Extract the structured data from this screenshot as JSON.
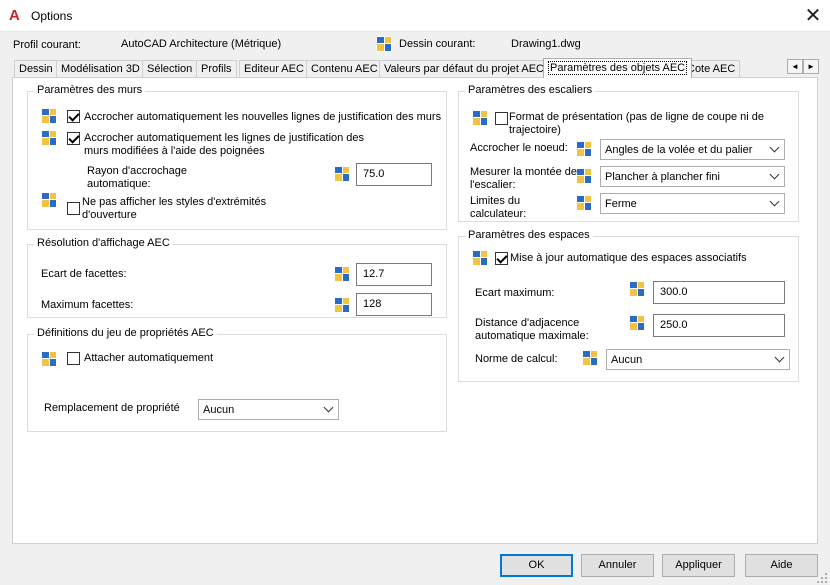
{
  "window": {
    "title": "Options",
    "close": "✕"
  },
  "header": {
    "profile_label": "Profil courant:",
    "profile_value": "AutoCAD Architecture (Métrique)",
    "drawing_label": "Dessin courant:",
    "drawing_value": "Drawing1.dwg"
  },
  "tabs": [
    "Dessin",
    "Modélisation 3D",
    "Sélection",
    "Profils",
    "Editeur AEC",
    "Contenu AEC",
    "Valeurs par défaut du projet AEC",
    "Paramètres des objets AEC",
    "Cote AEC"
  ],
  "active_tab_index": 7,
  "tab_scroll": {
    "left": "◄",
    "right": "►"
  },
  "walls": {
    "title": "Paramètres des murs",
    "snap_new": {
      "label": "Accrocher automatiquement les nouvelles lignes de justification des murs",
      "checked": true
    },
    "snap_modified": {
      "label": "Accrocher automatiquement les lignes de justification des murs modifiées à l'aide des poignées",
      "checked": true
    },
    "radius_label": "Rayon d'accrochage automatique:",
    "radius_value": "75.0",
    "hide_end_styles": {
      "label": "Ne pas afficher les styles d'extrémités d'ouverture",
      "checked": false
    }
  },
  "display": {
    "title": "Résolution d'affichage AEC",
    "facet_gap_label": "Ecart de facettes:",
    "facet_gap_value": "12.7",
    "max_facets_label": "Maximum facettes:",
    "max_facets_value": "128"
  },
  "propsets": {
    "title": "Définitions du jeu de propriétés AEC",
    "auto_attach": {
      "label": "Attacher automatiquement",
      "checked": false
    },
    "override_label": "Remplacement de propriété",
    "override_value": "Aucun"
  },
  "stairs": {
    "title": "Paramètres des escaliers",
    "presentation": {
      "label": "Format de présentation (pas de ligne de coupe ni de trajectoire)",
      "checked": false
    },
    "snap_node_label": "Accrocher le noeud:",
    "snap_node_value": "Angles de la volée et du palier",
    "measure_rise_label": "Mesurer la montée de l'escalier:",
    "measure_rise_value": "Plancher à plancher fini",
    "calc_limits_label": "Limites du calculateur:",
    "calc_limits_value": "Ferme"
  },
  "spaces": {
    "title": "Paramètres des espaces",
    "auto_update": {
      "label": "Mise à jour automatique des espaces associatifs",
      "checked": true
    },
    "max_gap_label": "Ecart maximum:",
    "max_gap_value": "300.0",
    "adjacency_label": "Distance d'adjacence automatique maximale:",
    "adjacency_value": "250.0",
    "calc_standard_label": "Norme de calcul:",
    "calc_standard_value": "Aucun"
  },
  "buttons": {
    "ok": "OK",
    "cancel": "Annuler",
    "apply": "Appliquer",
    "help": "Aide"
  },
  "colors": {
    "accent": "#0078d7",
    "app_icon": "#d01f2b"
  }
}
